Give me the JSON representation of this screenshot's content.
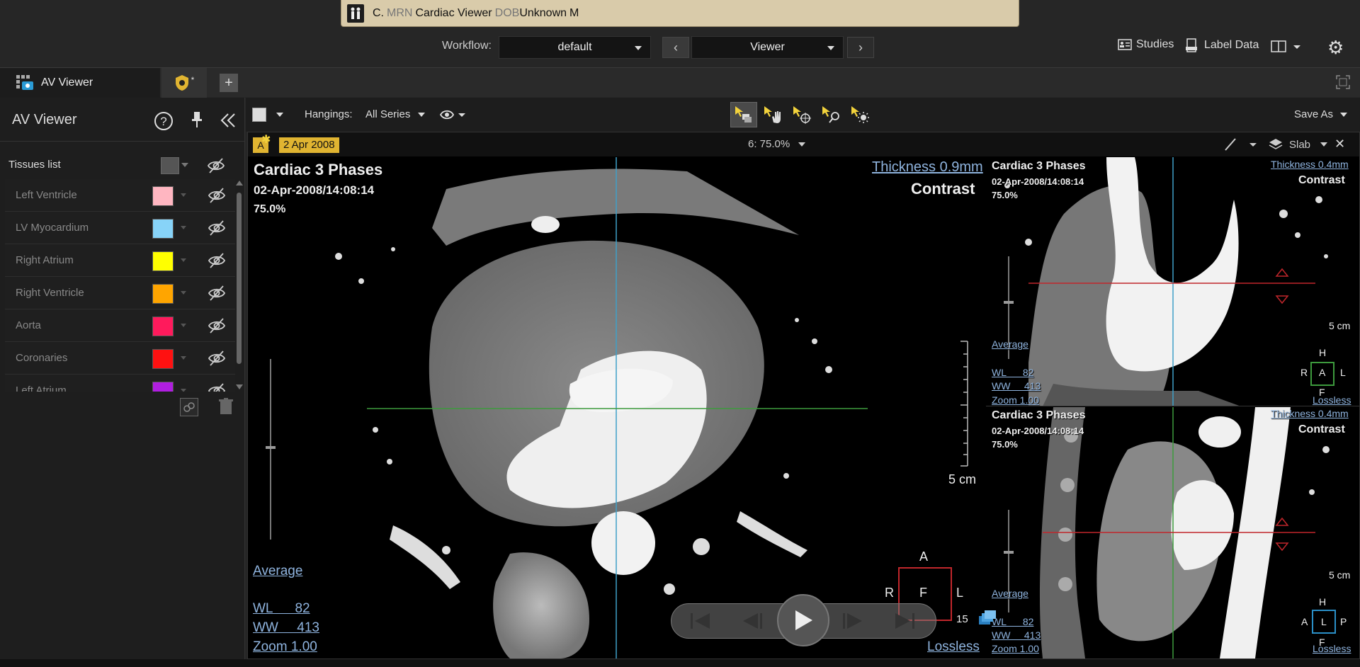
{
  "patient": {
    "initial": "C.",
    "mrn_label": "MRN",
    "name": "Cardiac Viewer",
    "dob_label": "DOB",
    "dob": "Unknown",
    "sex": "M"
  },
  "workflow": {
    "label": "Workflow:",
    "value": "default",
    "stage": "Viewer"
  },
  "header_right": {
    "studies": "Studies",
    "label_data": "Label Data"
  },
  "tabs": [
    {
      "label": "AV Viewer"
    },
    {
      "label": "*"
    }
  ],
  "left_panel": {
    "title": "AV Viewer",
    "tissues_label": "Tissues list",
    "tissues": [
      {
        "name": "Left Ventricle",
        "color": "#ffb6c1"
      },
      {
        "name": "LV Myocardium",
        "color": "#87d3f8"
      },
      {
        "name": "Right Atrium",
        "color": "#ffff00"
      },
      {
        "name": "Right Ventricle",
        "color": "#ffa500"
      },
      {
        "name": "Aorta",
        "color": "#ff1a5c"
      },
      {
        "name": "Coronaries",
        "color": "#ff1111"
      },
      {
        "name": "Left Atrium",
        "color": "#b01ee0"
      }
    ]
  },
  "toolbar": {
    "hangings_label": "Hangings:",
    "hangings_value": "All Series",
    "save_as": "Save As"
  },
  "viewer_header": {
    "a_badge": "A",
    "date": "2 Apr 2008",
    "zoom": "6: 75.0%",
    "slab": "Slab"
  },
  "main_view": {
    "title": "Cardiac 3 Phases",
    "datetime": "02-Apr-2008/14:08:14",
    "zoom_pct": "75.0%",
    "thickness": "Thickness 0.9mm",
    "contrast": "Contrast",
    "average": "Average",
    "wl": "WL      82",
    "ww": "WW     413",
    "zoom": "Zoom 1.00",
    "scale": "5 cm",
    "lossless": "Lossless",
    "orient": {
      "top": "A",
      "left": "R",
      "center": "F",
      "right": "L"
    }
  },
  "top_right_view": {
    "title": "Cardiac 3 Phases",
    "datetime": "02-Apr-2008/14:08:14",
    "zoom_pct": "75.0%",
    "thickness": "Thickness 0.4mm",
    "contrast": "Contrast",
    "average": "Average",
    "wl": "WL      82",
    "ww": "WW     413",
    "zoom": "Zoom 1.00",
    "scale": "5 cm",
    "lossless": "Lossless",
    "orient": {
      "top": "H",
      "left": "R",
      "center": "A",
      "right": "L",
      "bottom": "F"
    }
  },
  "bottom_right_view": {
    "title": "Cardiac 3 Phases",
    "datetime": "02-Apr-2008/14:08:14",
    "zoom_pct": "75.0%",
    "thickness": "Thickness 0.4mm",
    "contrast": "Contrast",
    "average": "Average",
    "wl": "WL      82",
    "ww": "WW     413",
    "zoom": "Zoom 1.00",
    "scale": "5 cm",
    "lossless": "Lossless",
    "orient": {
      "top": "H",
      "left": "A",
      "center": "L",
      "right": "P",
      "bottom": "F"
    }
  },
  "player": {
    "frame": "15"
  }
}
